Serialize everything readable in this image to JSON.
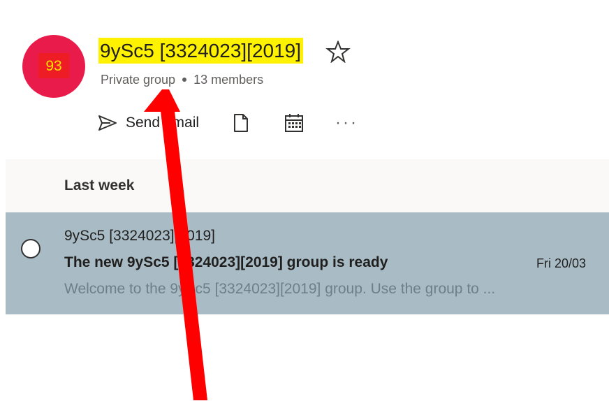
{
  "group": {
    "avatar_text": "93",
    "title": "9ySc5 [3324023][2019]",
    "privacy": "Private group",
    "members": "13 members"
  },
  "toolbar": {
    "send_email_label": "Send email",
    "more_label": "···"
  },
  "list": {
    "section_label": "Last week",
    "messages": [
      {
        "sender": "9ySc5 [3324023][2019]",
        "subject": "The new 9ySc5 [3324023][2019] group is ready",
        "date": "Fri 20/03",
        "preview": "Welcome to the 9ySc5 [3324023][2019] group. Use the group to ..."
      }
    ]
  },
  "icons": {
    "star": "star-outline-icon",
    "send": "send-icon",
    "file": "file-icon",
    "calendar": "calendar-icon",
    "radio": "radio-unchecked-icon"
  },
  "colors": {
    "avatar_bg": "#e81b4a",
    "avatar_highlight": "#ee1c24",
    "avatar_text": "#ffe100",
    "title_highlight": "#fff200",
    "selected_row": "#a9bcc6",
    "annotation_arrow": "#ff0000"
  }
}
